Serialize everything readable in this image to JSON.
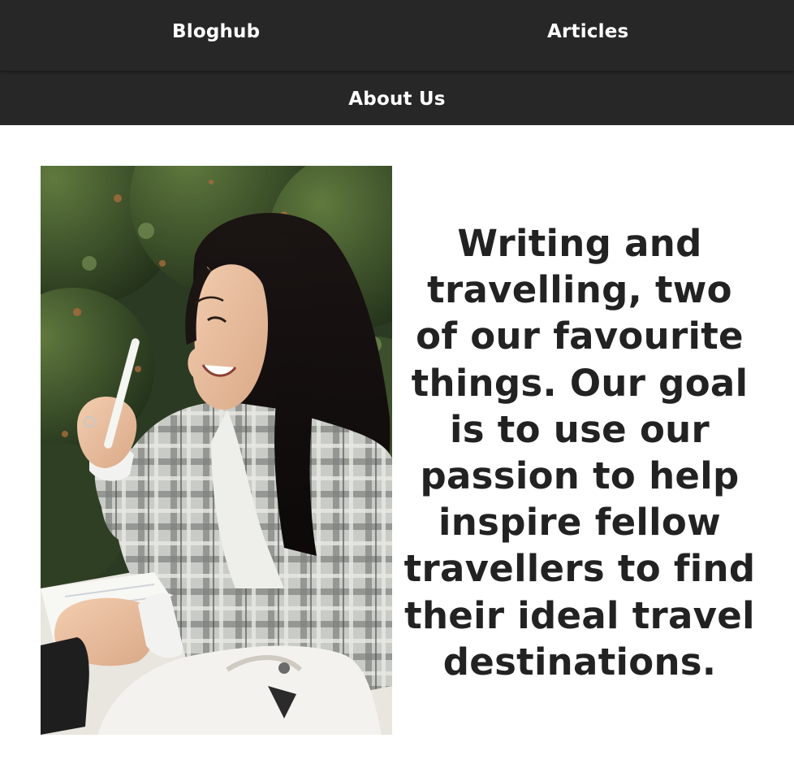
{
  "nav": {
    "brand": "Bloghub",
    "links": [
      {
        "label": "Articles"
      },
      {
        "label": "About Us"
      }
    ]
  },
  "hero": {
    "photo": "woman-writing-photo",
    "tagline": "Writing and travelling, two of our favourite things. Our goal is to use our passion to help inspire fellow travellers to find their ideal travel destinations."
  },
  "colors": {
    "nav_background": "#272727",
    "nav_text": "#ffffff",
    "body_text": "#222222",
    "page_background": "#ffffff"
  }
}
